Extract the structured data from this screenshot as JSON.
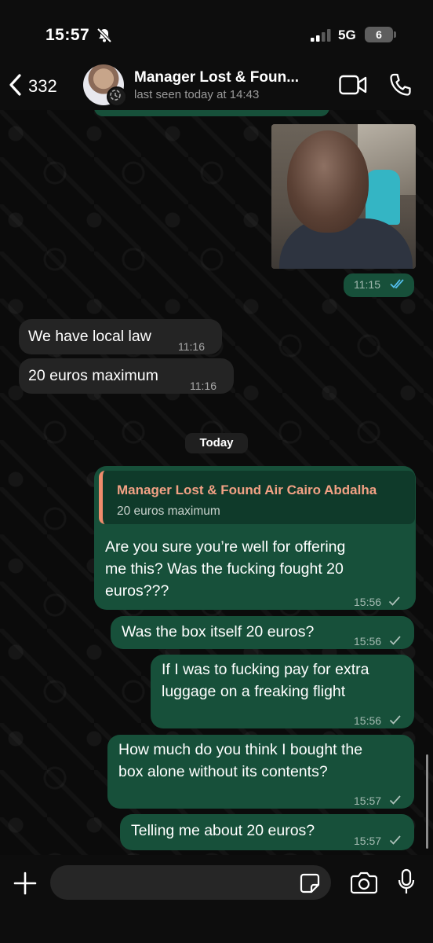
{
  "status_bar": {
    "time": "15:57",
    "network": "5G",
    "battery": "6"
  },
  "header": {
    "back_count": "332",
    "contact_name": "Manager Lost & Foun...",
    "contact_status": "last seen today at 14:43"
  },
  "messages": {
    "photo": {
      "time": "11:15"
    },
    "in1": {
      "text": "We have local law",
      "time": "11:16"
    },
    "in2": {
      "text": "20 euros maximum",
      "time": "11:16"
    },
    "day_label": "Today",
    "reply": {
      "quote_name": "Manager Lost & Found Air Cairo Abdalha",
      "quote_text": "20 euros maximum",
      "line1": "Are you sure you’re well for offering",
      "line2": "me this? Was the fucking fought 20",
      "line3": "euros???",
      "time": "15:56"
    },
    "out2": {
      "text": "Was the box itself 20 euros?",
      "time": "15:56"
    },
    "out3": {
      "line1": "If I was to fucking pay for extra",
      "line2": "luggage on a freaking flight",
      "time": "15:56"
    },
    "out4": {
      "line1": "How much do you think I bought the",
      "line2": "box alone without its contents?",
      "time": "15:57"
    },
    "out5": {
      "text": "Telling me about 20 euros?",
      "time": "15:57"
    }
  },
  "input": {
    "placeholder": ""
  },
  "colors": {
    "outgoing_bubble": "#17503a",
    "incoming_bubble": "#242424",
    "quote_accent": "#f08c6c",
    "read_receipt": "#53bdeb",
    "background": "#0b0b0b"
  },
  "icons": [
    "bell-slash-icon",
    "signal-icon",
    "back-chevron-icon",
    "video-call-icon",
    "phone-icon",
    "double-check-icon",
    "check-icon",
    "plus-icon",
    "sticker-icon",
    "camera-icon",
    "microphone-icon"
  ]
}
